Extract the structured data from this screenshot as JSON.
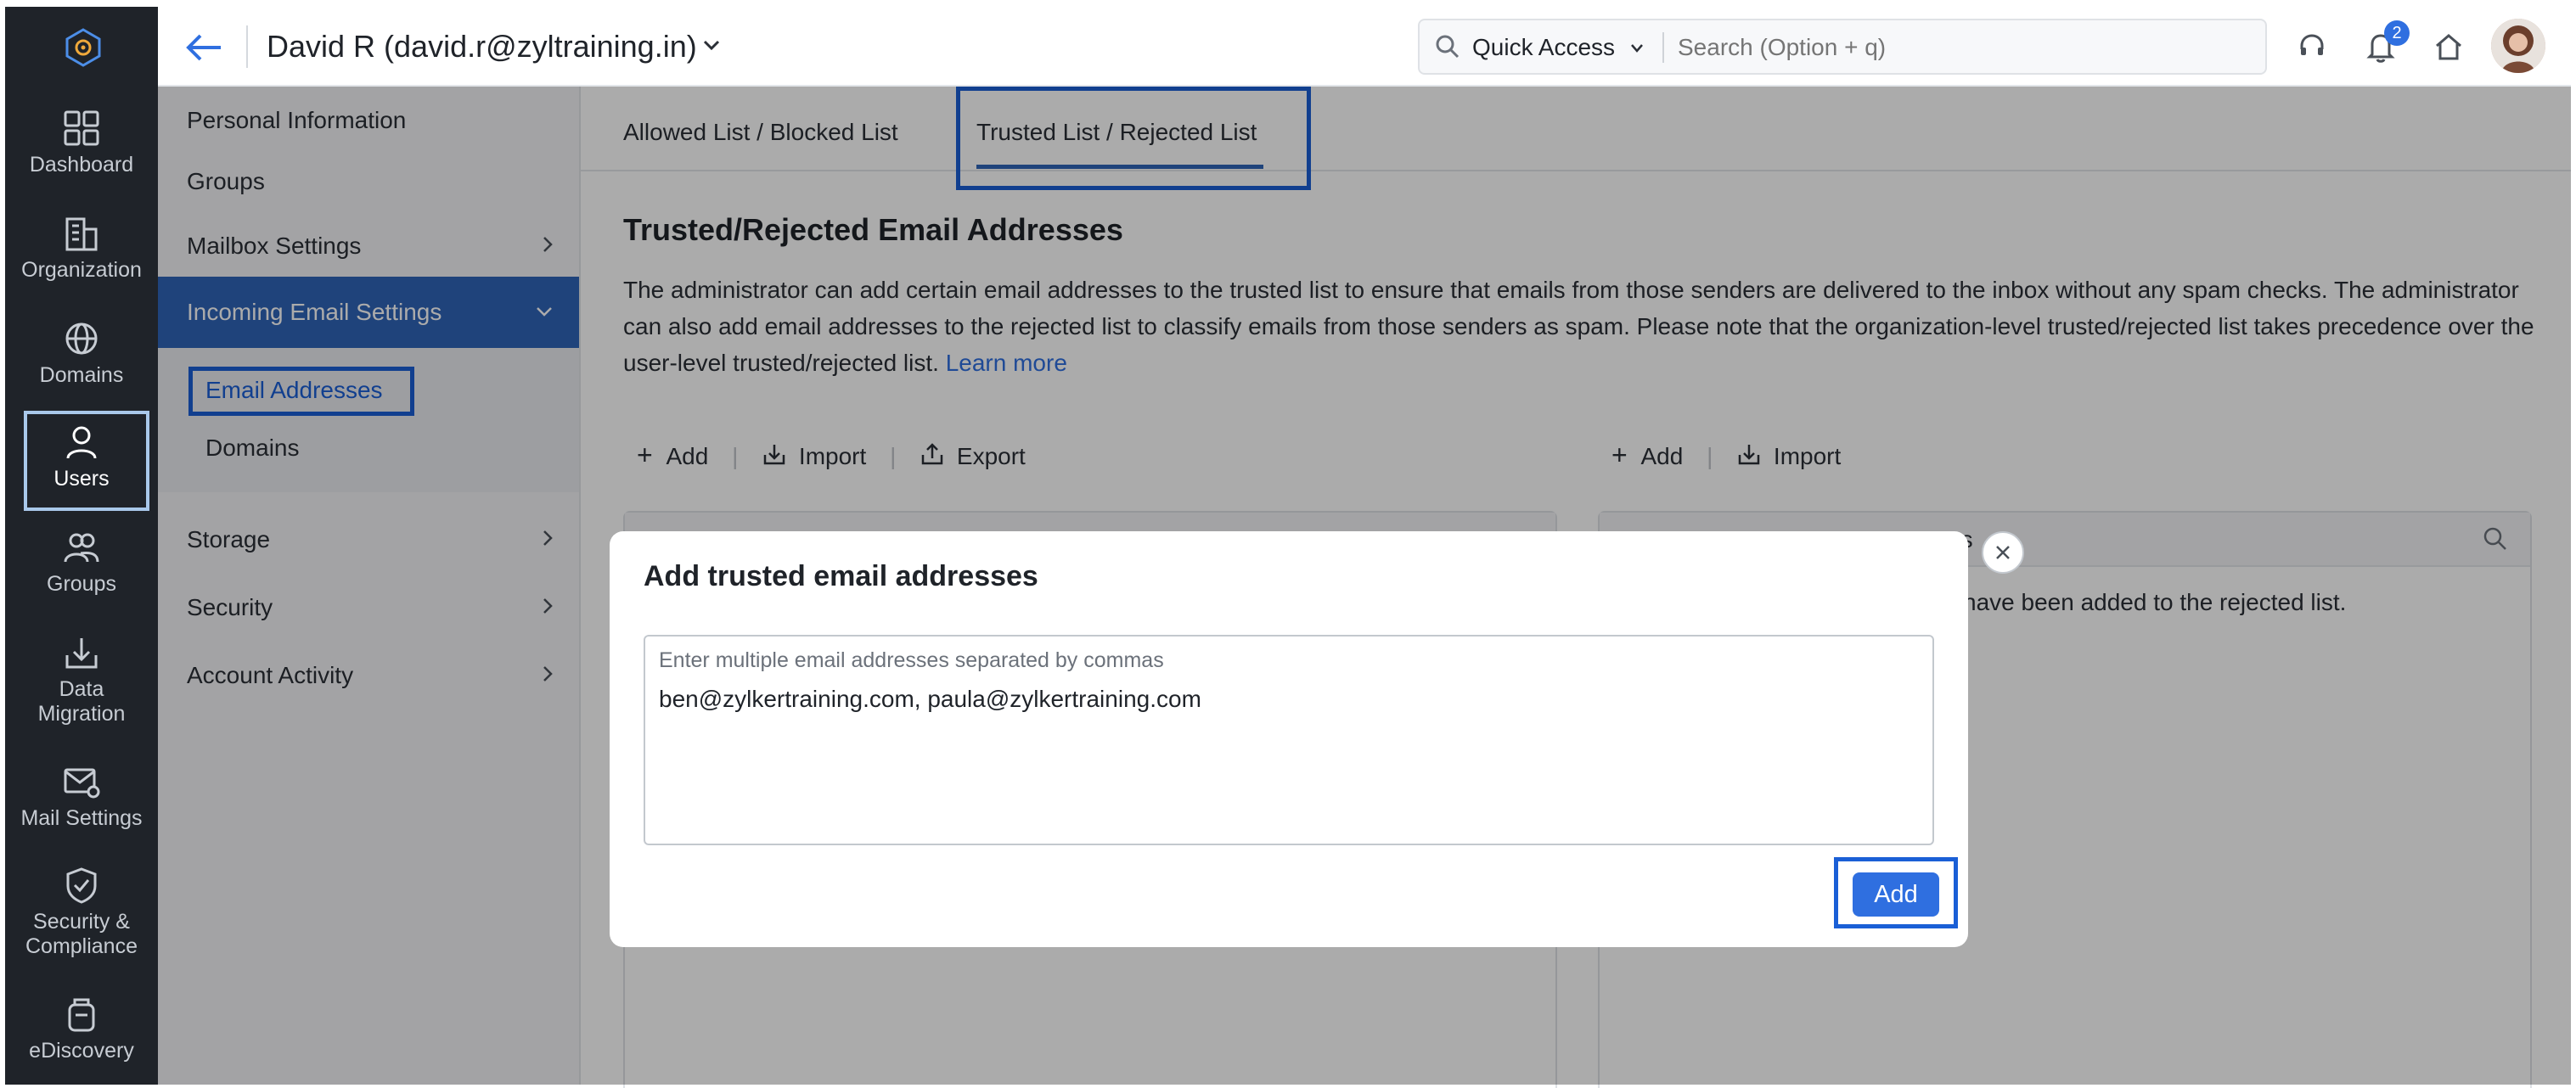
{
  "rail": {
    "items": [
      {
        "label": "Dashboard",
        "icon": "dashboard-icon"
      },
      {
        "label": "Organization",
        "icon": "organization-icon"
      },
      {
        "label": "Domains",
        "icon": "globe-icon"
      },
      {
        "label": "Users",
        "icon": "user-icon"
      },
      {
        "label": "Groups",
        "icon": "groups-icon"
      },
      {
        "label": "Data Migration",
        "icon": "migration-icon"
      },
      {
        "label": "Mail Settings",
        "icon": "mail-settings-icon"
      },
      {
        "label": "Security & Compliance",
        "icon": "shield-icon"
      },
      {
        "label": "eDiscovery",
        "icon": "ediscovery-icon"
      }
    ]
  },
  "header": {
    "user_title": "David R (david.r@zyltraining.in)",
    "quick_access": "Quick Access",
    "search_placeholder": "Search (Option + q)",
    "notification_count": "2"
  },
  "settings_nav": {
    "personal_information": "Personal Information",
    "groups": "Groups",
    "mailbox_settings": "Mailbox Settings",
    "incoming_email_settings": "Incoming Email Settings",
    "email_addresses": "Email Addresses",
    "domains": "Domains",
    "storage": "Storage",
    "security": "Security",
    "account_activity": "Account Activity"
  },
  "tabs": {
    "allowed_blocked": "Allowed List / Blocked List",
    "trusted_rejected": "Trusted List / Rejected List"
  },
  "content": {
    "title": "Trusted/Rejected Email Addresses",
    "description": "The administrator can add certain email addresses to the trusted list to ensure that emails from those senders are delivered to the inbox without any spam checks. The administrator can also add email addresses to the rejected list to classify emails from those senders as spam. Please note that the organization-level trusted/rejected list takes precedence over the user-level trusted/rejected list.",
    "learn_more": "Learn more",
    "left_toolbar": {
      "add": "Add",
      "import": "Import",
      "export": "Export"
    },
    "right_toolbar": {
      "add": "Add",
      "import": "Import"
    },
    "right_header_partial": "es",
    "rejected_empty_partial": "have been added to the rejected list."
  },
  "dialog": {
    "title": "Add trusted email addresses",
    "textarea_placeholder": "Enter multiple email addresses separated by commas",
    "textarea_value": "ben@zylkertraining.com, paula@zylkertraining.com",
    "add_button": "Add"
  },
  "colors": {
    "accent": "#1a5fd6",
    "rail_bg": "#1f2329",
    "nav_active_bg": "#2f64b8",
    "button_bg": "#2f6fe0"
  }
}
